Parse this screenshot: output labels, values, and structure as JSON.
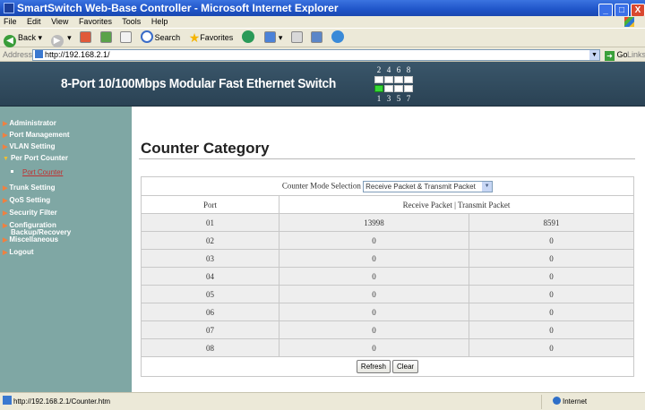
{
  "window": {
    "title": "SmartSwitch Web-Base Controller - Microsoft Internet Explorer",
    "min": "_",
    "max": "□",
    "close": "X"
  },
  "menu": [
    "File",
    "Edit",
    "View",
    "Favorites",
    "Tools",
    "Help"
  ],
  "toolbar": {
    "back": "Back",
    "search": "Search",
    "favorites": "Favorites"
  },
  "address": {
    "label": "Address",
    "url": "http://192.168.2.1/",
    "go": "Go",
    "links": "Links"
  },
  "banner": {
    "title": "8-Port 10/100Mbps Modular Fast Ethernet Switch",
    "top_ports": [
      "2",
      "4",
      "6",
      "8"
    ],
    "bottom_ports": [
      "1",
      "3",
      "5",
      "7"
    ],
    "active_port": "1"
  },
  "sidebar": {
    "items": [
      {
        "label": "Administrator"
      },
      {
        "label": "Port Management"
      },
      {
        "label": "VLAN Setting"
      },
      {
        "label": "Per Port Counter"
      },
      {
        "label": "Trunk Setting"
      },
      {
        "label": "QoS Setting"
      },
      {
        "label": "Security Filter"
      },
      {
        "label": "Configuration"
      },
      {
        "label": "Backup/Recovery"
      },
      {
        "label": "Miscellaneous"
      },
      {
        "label": "Logout"
      }
    ],
    "subitem": "Port Counter"
  },
  "main": {
    "title": "Counter Category",
    "mode_label": "Counter Mode Selection",
    "mode_value": "Receive Packet & Transmit Packet",
    "col_port": "Port",
    "col_counter": "Receive Packet | Transmit Packet",
    "rows": [
      {
        "port": "01",
        "rx": "13998",
        "tx": "8591"
      },
      {
        "port": "02",
        "rx": "0",
        "tx": "0"
      },
      {
        "port": "03",
        "rx": "0",
        "tx": "0"
      },
      {
        "port": "04",
        "rx": "0",
        "tx": "0"
      },
      {
        "port": "05",
        "rx": "0",
        "tx": "0"
      },
      {
        "port": "06",
        "rx": "0",
        "tx": "0"
      },
      {
        "port": "07",
        "rx": "0",
        "tx": "0"
      },
      {
        "port": "08",
        "rx": "0",
        "tx": "0"
      }
    ],
    "refresh": "Refresh",
    "clear": "Clear"
  },
  "status": {
    "url": "http://192.168.2.1/Counter.htm",
    "zone": "Internet"
  }
}
